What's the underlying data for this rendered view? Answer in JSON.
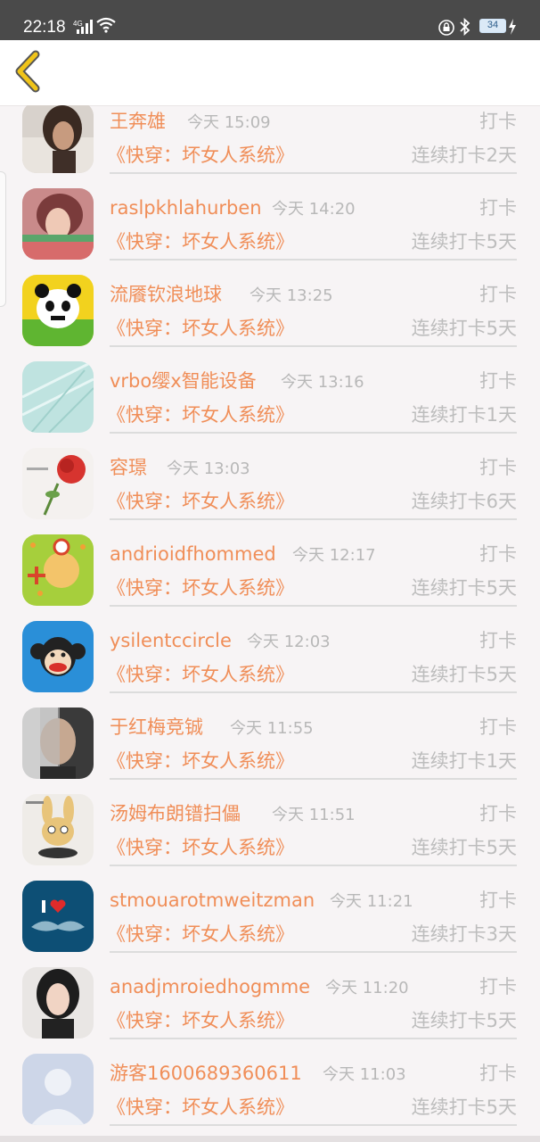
{
  "status_bar": {
    "time": "22:18",
    "network": "4G",
    "battery": "34",
    "icons": [
      "signal-icon",
      "wifi-icon",
      "lock-icon",
      "bluetooth-icon",
      "battery-icon",
      "charging-icon"
    ]
  },
  "header": {
    "back_icon": "chevron-left-icon",
    "accent": "#f0c419"
  },
  "colors": {
    "name": "#f08e58",
    "muted": "#bdbdbd",
    "background": "#f7f4f5"
  },
  "rows": [
    {
      "name": "王奔雄",
      "time": "今天 15:09",
      "action": "打卡",
      "book": "《快穿：坏女人系统》",
      "streak": "连续打卡2天"
    },
    {
      "name": "raslpkhlahurben",
      "time": "今天 14:20",
      "action": "打卡",
      "book": "《快穿：坏女人系统》",
      "streak": "连续打卡5天"
    },
    {
      "name": "流餍钦浪地球",
      "time": "今天 13:25",
      "action": "打卡",
      "book": "《快穿：坏女人系统》",
      "streak": "连续打卡5天"
    },
    {
      "name": "vrbo缨x智能设备",
      "time": "今天 13:16",
      "action": "打卡",
      "book": "《快穿：坏女人系统》",
      "streak": "连续打卡1天"
    },
    {
      "name": "容璟",
      "time": "今天 13:03",
      "action": "打卡",
      "book": "《快穿：坏女人系统》",
      "streak": "连续打卡6天"
    },
    {
      "name": "andrioidfhommed",
      "time": "今天 12:17",
      "action": "打卡",
      "book": "《快穿：坏女人系统》",
      "streak": "连续打卡5天"
    },
    {
      "name": "ysilentccircle",
      "time": "今天 12:03",
      "action": "打卡",
      "book": "《快穿：坏女人系统》",
      "streak": "连续打卡5天"
    },
    {
      "name": "于红梅竞铖",
      "time": "今天 11:55",
      "action": "打卡",
      "book": "《快穿：坏女人系统》",
      "streak": "连续打卡1天"
    },
    {
      "name": "汤姆布朗镨扫儡",
      "time": "今天 11:51",
      "action": "打卡",
      "book": "《快穿：坏女人系统》",
      "streak": "连续打卡5天"
    },
    {
      "name": "stmouarotmweitzman",
      "time": "今天 11:21",
      "action": "打卡",
      "book": "《快穿：坏女人系统》",
      "streak": "连续打卡3天"
    },
    {
      "name": "anadjmroiedhogmme",
      "time": "今天 11:20",
      "action": "打卡",
      "book": "《快穿：坏女人系统》",
      "streak": "连续打卡5天"
    },
    {
      "name": "游客1600689360611",
      "time": "今天 11:03",
      "action": "打卡",
      "book": "《快穿：坏女人系统》",
      "streak": "连续打卡5天"
    }
  ]
}
